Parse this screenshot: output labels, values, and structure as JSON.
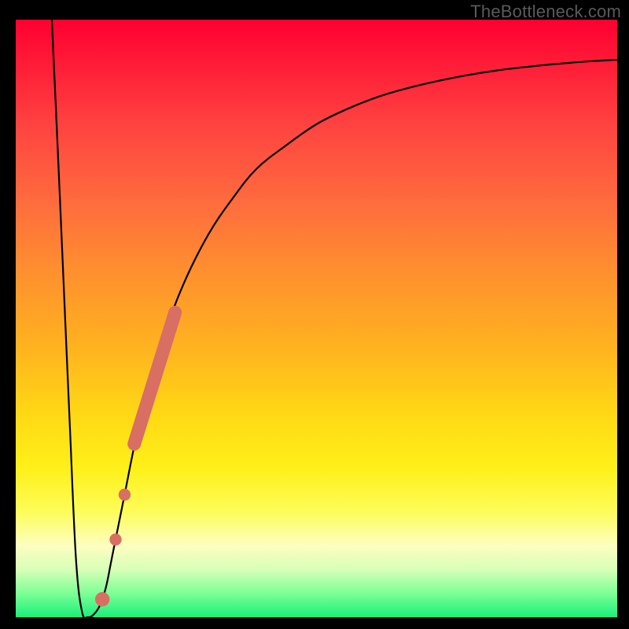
{
  "watermark": "TheBottleneck.com",
  "colors": {
    "background": "#000000",
    "gradient_top": "#ff0030",
    "gradient_bottom": "#19ef7c",
    "curve": "#000000",
    "dot": "#d96e63"
  },
  "chart_data": {
    "type": "line",
    "title": "",
    "xlabel": "",
    "ylabel": "",
    "xlim": [
      0,
      100
    ],
    "ylim": [
      0,
      100
    ],
    "series": [
      {
        "name": "curve",
        "x": [
          6,
          7,
          8,
          9,
          10,
          11,
          12,
          13,
          14,
          15,
          16,
          18,
          20,
          22,
          25,
          28,
          32,
          36,
          40,
          45,
          50,
          55,
          60,
          65,
          70,
          75,
          80,
          85,
          90,
          95,
          100
        ],
        "values": [
          100,
          78,
          55,
          32,
          10,
          1,
          0,
          0.5,
          2,
          5,
          10,
          20,
          30,
          38,
          48,
          56,
          64,
          70,
          75,
          79,
          82.5,
          85,
          87,
          88.5,
          89.7,
          90.7,
          91.5,
          92.1,
          92.6,
          93,
          93.3
        ]
      }
    ],
    "markers": [
      {
        "name": "salmon-segment",
        "shape": "roundrect",
        "x0": 19.7,
        "y0": 29.0,
        "x1": 26.5,
        "y1": 51.0
      },
      {
        "name": "salmon-dot-1",
        "shape": "circle",
        "x": 18.1,
        "y": 20.5,
        "r": 1.0
      },
      {
        "name": "salmon-dot-2",
        "shape": "circle",
        "x": 16.6,
        "y": 13.0,
        "r": 1.0
      },
      {
        "name": "salmon-dot-3",
        "shape": "circle",
        "x": 14.4,
        "y": 3.0,
        "r": 1.2
      }
    ]
  }
}
